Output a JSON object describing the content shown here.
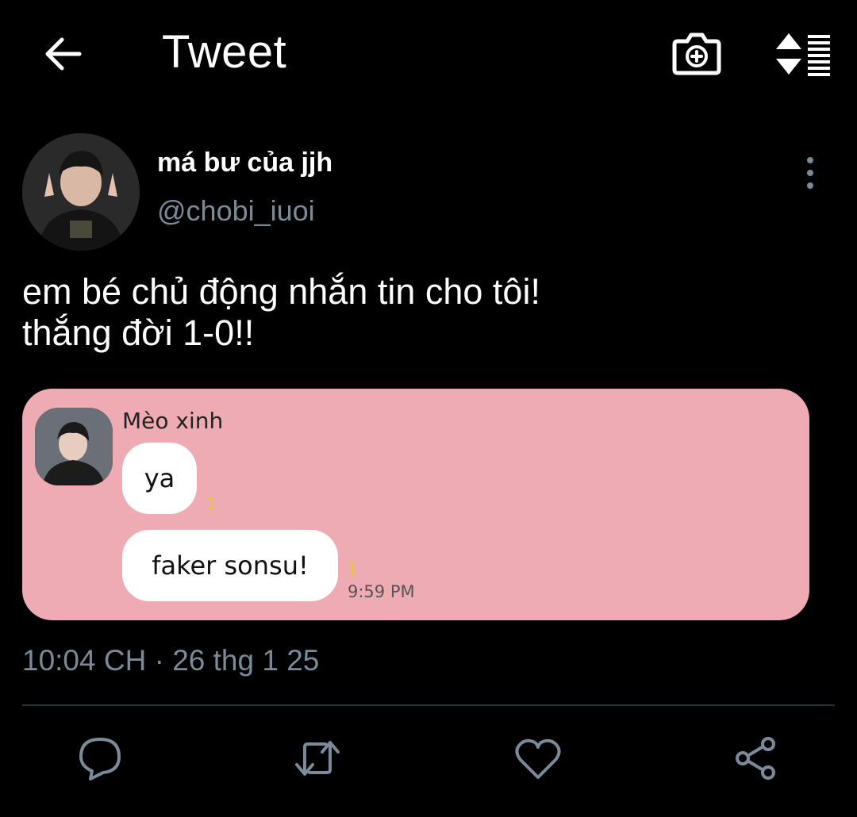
{
  "header": {
    "title": "Tweet"
  },
  "tweet": {
    "display_name": "má bư của jjh",
    "handle": "@chobi_iuoi",
    "text_line1": "em bé chủ động nhắn tin cho tôi!",
    "text_line2": "thắng đời 1-0!!",
    "timestamp": "10:04 CH · 26 thg 1 25"
  },
  "chat_image": {
    "sender": "Mèo xinh",
    "messages": [
      {
        "text": "ya",
        "unread": "1"
      },
      {
        "text": "faker sonsu!",
        "unread": "1",
        "time": "9:59 PM"
      }
    ]
  },
  "colors": {
    "background": "#000000",
    "secondary_text": "#7b8a99",
    "card_pink": "#efabb4",
    "unread_yellow": "#e6c93a"
  },
  "icons": [
    "back-arrow-icon",
    "camera-plus-icon",
    "sort-icon",
    "more-vertical-icon",
    "reply-icon",
    "retweet-icon",
    "like-icon",
    "share-icon"
  ]
}
